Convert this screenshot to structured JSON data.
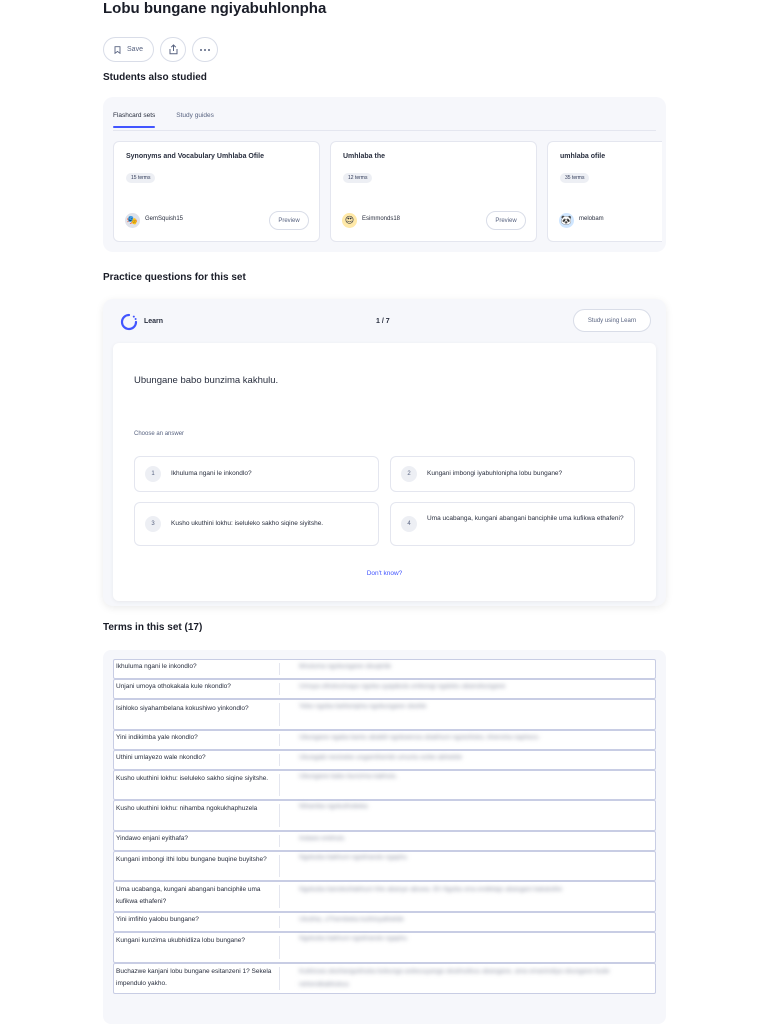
{
  "page": {
    "title": "Lobu bungane ngiyabuhlonpha"
  },
  "actions": {
    "save_label": "Save",
    "save_icon": "bookmark-icon",
    "share_icon": "share-icon",
    "more_icon": "more-icon"
  },
  "studied": {
    "heading": "Students also studied",
    "tabs": [
      {
        "label": "Flashcard sets"
      },
      {
        "label": "Study guides"
      }
    ],
    "cards": [
      {
        "title": "Synonyms and Vocabulary Umhlaba Ofile",
        "terms": "15 terms",
        "author": "GemSquish15",
        "avatar": "🎭",
        "preview": "Preview"
      },
      {
        "title": "Umhlaba the",
        "terms": "12 terms",
        "author": "Esimmonds18",
        "avatar": "😍",
        "preview": "Preview"
      },
      {
        "title": "umhlaba ofile",
        "terms": "35 terms",
        "author": "melobam",
        "avatar": "🐼",
        "preview": "Preview"
      }
    ]
  },
  "practice": {
    "heading": "Practice questions for this set",
    "mode": "Learn",
    "counter": "1 / 7",
    "study_button": "Study using Learn",
    "question": "Ubungane babo bunzima kakhulu.",
    "choose_label": "Choose an answer",
    "answers": [
      {
        "num": "1",
        "text": "Ikhuluma ngani le inkondlo?"
      },
      {
        "num": "2",
        "text": "Kungani imbongi iyabuhlonipha lobu bungane?"
      },
      {
        "num": "3",
        "text": "Kusho ukuthini lokhu: iseluleko sakho siqine siyitshe."
      },
      {
        "num": "4",
        "text": "Uma ucabanga, kungani abangani banciphile uma kufikwa ethafeni?"
      }
    ],
    "dont_know": "Don't know?"
  },
  "terms": {
    "heading": "Terms in this set (17)",
    "rows": [
      {
        "term": "Ikhuluma ngani le inkondlo?",
        "definition": "Ikhuluma ngobungane obuqinile"
      },
      {
        "term": "Unjani umoya othokakala kule nkondlo?",
        "definition": "Umoya othokozisayo ngoba uyajabula umbongi ngaloku abanobungane"
      },
      {
        "term": "Isihloko siyahambelana kokushiwo yinkondlo?",
        "definition": "Yebo ngoba bahlonipha ngobungane obuhle"
      },
      {
        "term": "Yini indikimba yale nkondlo?",
        "definition": "Ubungane ngaba bantu ababili ngokwenza obakhuni ngoluhloko, khensha naphezu"
      },
      {
        "term": "Uthini umlayezo wale nkondlo?",
        "definition": "Ukungabi nesineke ungamthembi umuntu ezike abhekile"
      },
      {
        "term": "Kusho ukuthini lokhu: iseluleko sakho siqine siyitshe.",
        "definition": "Ubungane babo bunzima kakhulu."
      },
      {
        "term": "Kusho ukuthini lokhu: nihamba ngokukhaphuzela",
        "definition": "Nihamba ngokuthobeka"
      },
      {
        "term": "Yindawo enjani eyithafa?",
        "definition": "Indawo enkhulu"
      },
      {
        "term": "Kungani imbongi ithi lobu bungane buqine buyitshe?",
        "definition": "Ngokuba bakhuni ngokhando ngaphu"
      },
      {
        "term": "Uma ucabanga, kungani abangani banciphile uma kufikwa ethafeni?",
        "definition": "Ngokuba banobuhlakhuni hhe abanye abuwa. Eh Ngoba sina endlelajo abangani bakaluthe"
      },
      {
        "term": "Yini imfihlo yalobu bungane?",
        "definition": "Ukuthia, uThembeka kuthinyathekile"
      },
      {
        "term": "Kungani kunzima ukubhidliza lobu bungane?",
        "definition": "Ngokuba bakhuni ngokhando ngaphu"
      },
      {
        "term": "Buchazwe kanjani lobu bungane esitanzeni 1? Sekela impendulo yakho.",
        "definition": "Kubhcwa ubuhlangukhuba bobunga asilwuuyanga obukhulikuu abangane, ama emanindiya obungane bude nehendkabhukuu"
      }
    ]
  }
}
